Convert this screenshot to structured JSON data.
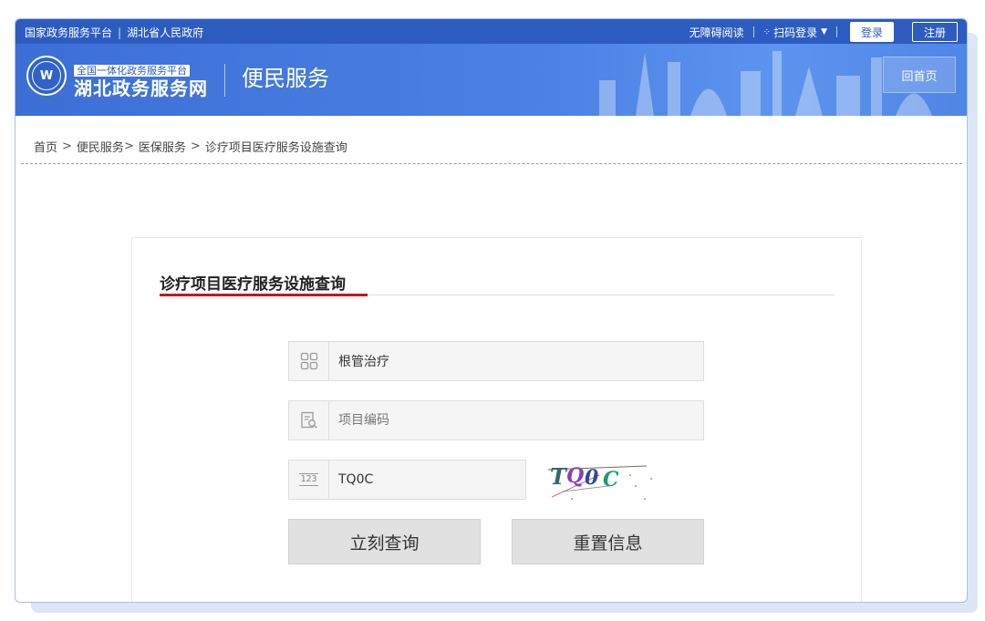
{
  "topbar": {
    "national_platform": "国家政务服务平台",
    "province_gov": "湖北省人民政府",
    "accessibility": "无障碍阅读",
    "scan_login": "扫码登录",
    "login": "登录",
    "register": "注册"
  },
  "header": {
    "site_subtitle": "全国一体化政务服务平台",
    "site_title": "湖北政务服务网",
    "section": "便民服务",
    "home_button": "回首页"
  },
  "breadcrumb": {
    "home": "首页",
    "level1": "便民服务",
    "level2": "医保服务",
    "current": "诊疗项目医疗服务设施查询"
  },
  "form": {
    "title": "诊疗项目医疗服务设施查询",
    "item_name": {
      "value": "根管治疗",
      "placeholder": ""
    },
    "item_code": {
      "value": "",
      "placeholder": "项目编码"
    },
    "captcha_input": {
      "value": "TQ0C",
      "placeholder": ""
    },
    "captcha_image_text": "TQ0C",
    "search_button": "立刻查询",
    "reset_button": "重置信息"
  },
  "colors": {
    "brand_blue": "#2d5cc1",
    "title_accent": "#c9141b",
    "button_gray": "#e1e1e1"
  },
  "icons": {
    "item_name": "grid-icon",
    "item_code": "document-search-icon",
    "captcha": "number-123-icon"
  }
}
